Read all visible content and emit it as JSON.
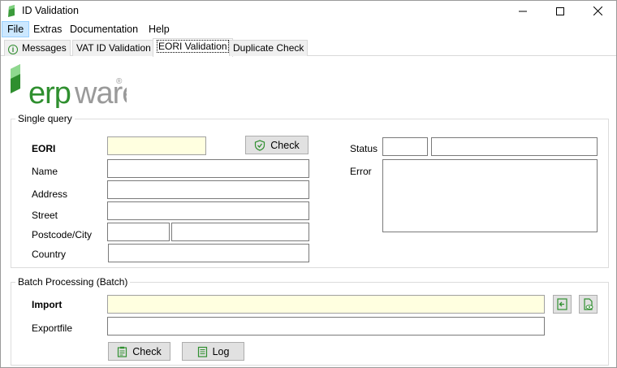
{
  "window": {
    "title": "ID Validation"
  },
  "menu": [
    {
      "label": "File"
    },
    {
      "label": "Extras"
    },
    {
      "label": "Documentation"
    },
    {
      "label": "Help"
    }
  ],
  "tabs": [
    {
      "label": "Messages"
    },
    {
      "label": "VAT ID Validation"
    },
    {
      "label": "EORI Validation"
    },
    {
      "label": "Duplicate Check"
    }
  ],
  "logo": {
    "text": "erpware"
  },
  "single_query": {
    "legend": "Single query",
    "eori_label": "EORI",
    "eori_value": "",
    "check_button": "Check",
    "name_label": "Name",
    "name_value": "",
    "address_label": "Address",
    "address_value": "",
    "street_label": "Street",
    "street_value": "",
    "postcode_city_label": "Postcode/City",
    "postcode_value": "",
    "city_value": "",
    "country_label": "Country",
    "country_value": "",
    "status_label": "Status",
    "status_code": "",
    "status_text": "",
    "error_label": "Error",
    "error_value": ""
  },
  "batch": {
    "legend": "Batch Processing (Batch)",
    "import_label": "Import",
    "import_value": "",
    "exportfile_label": "Exportfile",
    "exportfile_value": "",
    "check_button": "Check",
    "log_button": "Log"
  },
  "colors": {
    "brand_green": "#2f8f2f",
    "required_field": "#ffffe0",
    "menu_highlight": "#cce8ff"
  }
}
